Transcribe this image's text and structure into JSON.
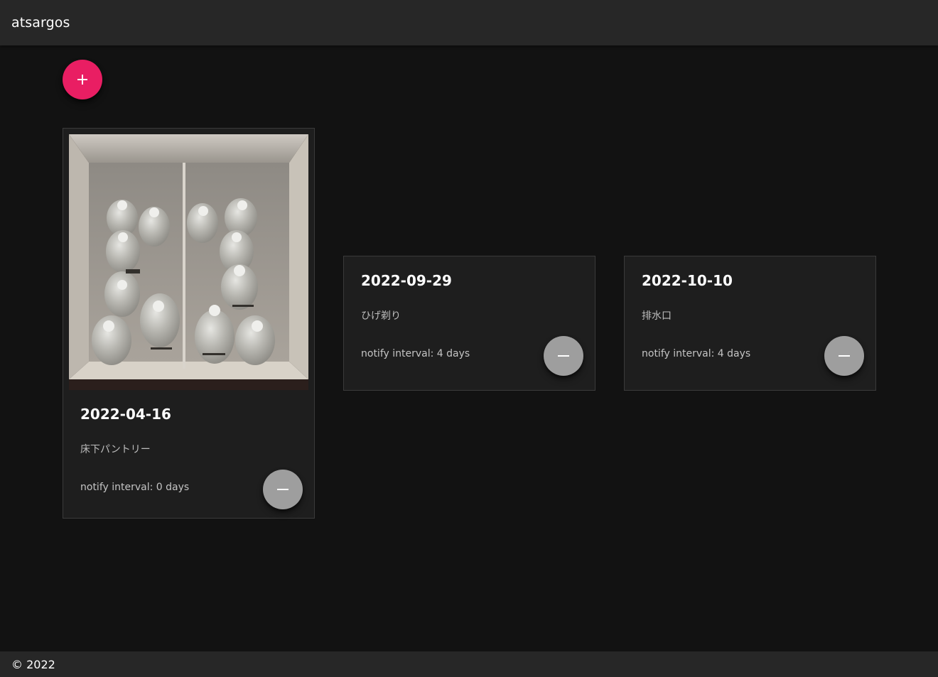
{
  "app": {
    "title": "atsargos"
  },
  "actions": {
    "add_icon": "plus-icon",
    "add_color": "#e91e63"
  },
  "items": [
    {
      "date": "2022-04-16",
      "name": "床下パントリー",
      "interval": "notify interval: 0 days",
      "has_image": true,
      "remove_icon": "minus-icon"
    },
    {
      "date": "2022-09-29",
      "name": "ひげ剃り",
      "interval": "notify interval: 4 days",
      "has_image": false,
      "remove_icon": "minus-icon"
    },
    {
      "date": "2022-10-10",
      "name": "排水口",
      "interval": "notify interval: 4 days",
      "has_image": false,
      "remove_icon": "minus-icon"
    }
  ],
  "footer": {
    "text": "© 2022"
  },
  "colors": {
    "background": "#121212",
    "bar": "#272727",
    "card": "#1e1e1e",
    "remove_button": "#9e9e9e"
  }
}
